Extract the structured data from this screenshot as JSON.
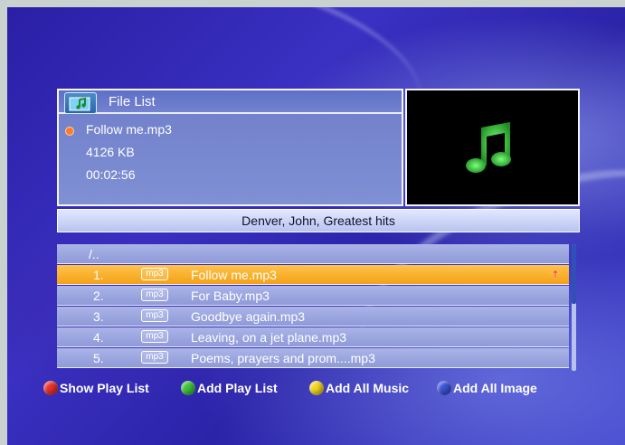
{
  "header": {
    "title": "File List",
    "icon": "music-folder-icon"
  },
  "file_info": {
    "filename": "Follow me.mp3",
    "size": "4126 KB",
    "duration": "00:02:56"
  },
  "preview": {
    "icon": "music-note-icon",
    "color": "#49e04a"
  },
  "album": "Denver, John, Greatest hits",
  "file_list": {
    "parent": "/..",
    "items": [
      {
        "num": "1.",
        "type": "mp3",
        "name": "Follow me.mp3",
        "selected": true
      },
      {
        "num": "2.",
        "type": "mp3",
        "name": "For Baby.mp3",
        "selected": false
      },
      {
        "num": "3.",
        "type": "mp3",
        "name": "Goodbye again.mp3",
        "selected": false
      },
      {
        "num": "4.",
        "type": "mp3",
        "name": "Leaving, on a jet plane.mp3",
        "selected": false
      },
      {
        "num": "5.",
        "type": "mp3",
        "name": "Poems, prayers and prom....mp3",
        "selected": false
      }
    ]
  },
  "legend": [
    {
      "color": "#e8322a",
      "label": "Show Play List"
    },
    {
      "color": "#3fc23a",
      "label": "Add Play List"
    },
    {
      "color": "#f2d61e",
      "label": "Add All  Music"
    },
    {
      "color": "#3a55d6",
      "label": "Add All Image"
    }
  ],
  "colors": {
    "selected_row": "#f4a216",
    "row": "#9ba6e0",
    "background": "#2e26b0"
  }
}
